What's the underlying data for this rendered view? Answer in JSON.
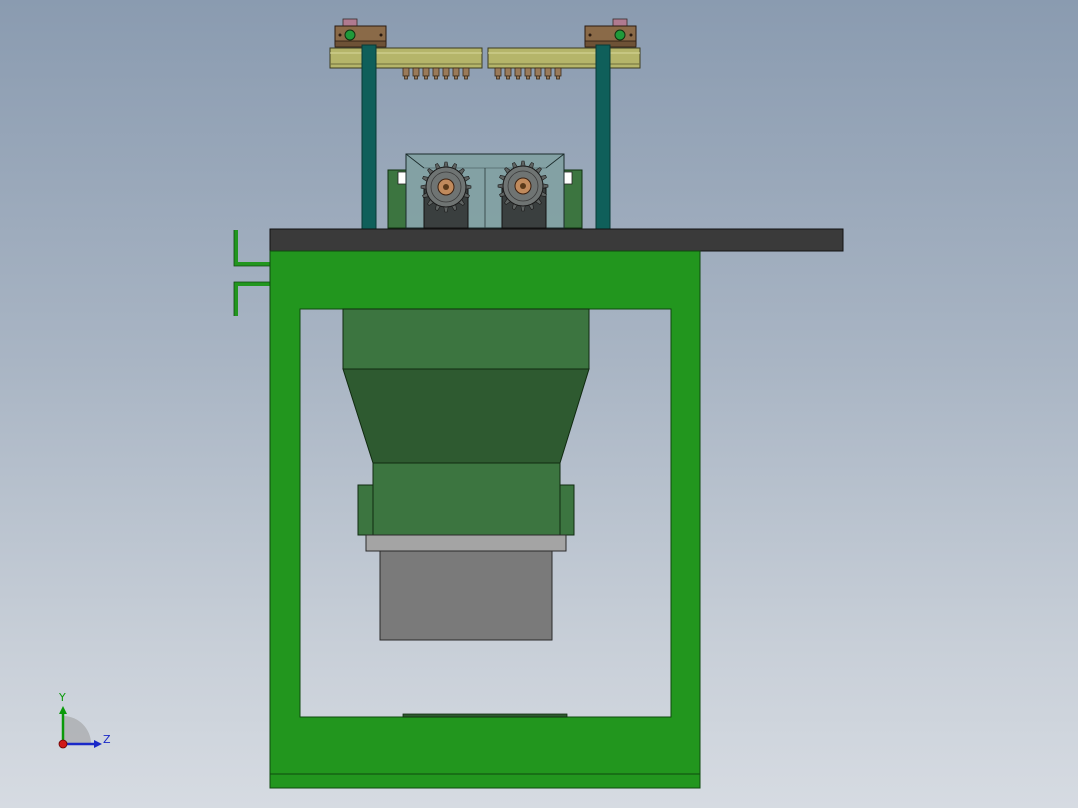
{
  "viewport": {
    "background_top": "#8a9bb0",
    "background_bottom": "#d6dbe2"
  },
  "colors": {
    "frame_green": "#22961e",
    "frame_edge": "#0f4a0e",
    "hopper_green": "#3c7540",
    "funnel_green": "#2e5a30",
    "table_top": "#3a3a3a",
    "rail_olive": "#b5b56a",
    "column_teal": "#0f5f5a",
    "clamp_brown": "#8a6a48",
    "gear_gray": "#6f7473",
    "hub_copper": "#c08a5c",
    "housing_glass": "#7fa0a0",
    "motor_gray": "#7a7a7a",
    "flange_gray": "#a4a4a4"
  },
  "triad": {
    "y_label": "Y",
    "z_label": "Z",
    "y_color": "#0a9a0a",
    "z_color": "#1a28c8",
    "origin_color": "#d01818"
  }
}
